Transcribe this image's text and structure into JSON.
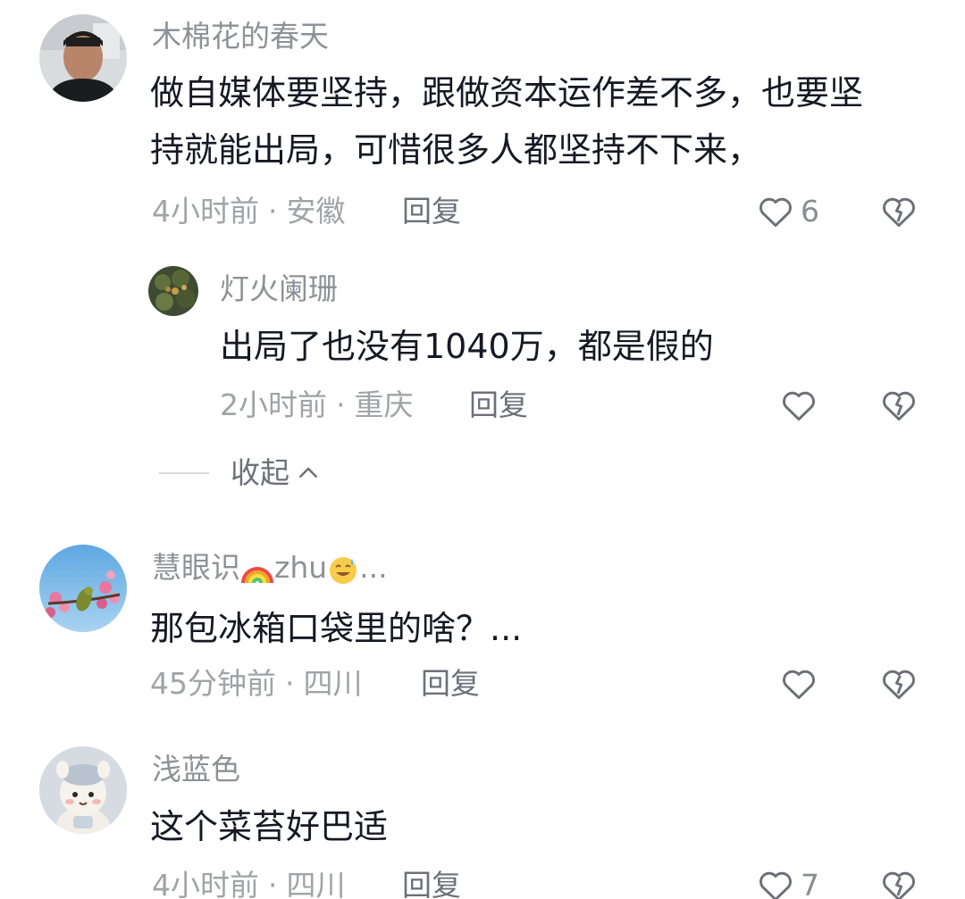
{
  "comments": [
    {
      "username": "木棉花的春天",
      "content_lines": [
        "做自媒体要坚持，跟做资本运作差不多，也要坚",
        "持就能出局，可惜很多人都坚持不下来，"
      ],
      "time": "4小时前",
      "location": "安徽",
      "reply_label": "回复",
      "likes": "6",
      "replies": [
        {
          "username": "灯火阑珊",
          "content": "出局了也没有1040万，都是假的",
          "time": "2小时前",
          "location": "重庆",
          "reply_label": "回复",
          "likes": ""
        }
      ],
      "collapse_label": "收起"
    },
    {
      "username_prefix": "慧眼识",
      "username_mid": "zhu",
      "username_suffix": "...",
      "content": "那包冰箱口袋里的啥？...",
      "time": "45分钟前",
      "location": "四川",
      "reply_label": "回复",
      "likes": ""
    },
    {
      "username": "浅蓝色",
      "content": "这个菜苔好巴适",
      "time": "4小时前",
      "location": "四川",
      "reply_label": "回复",
      "likes": "7"
    }
  ],
  "separator": "·",
  "icons": {
    "like": "heart-outline-icon",
    "dislike": "broken-heart-icon",
    "collapse": "chevron-up-icon"
  },
  "colors": {
    "username": "#8f9197",
    "content": "#161823",
    "meta": "#a1a3a8",
    "icon": "#6d7078"
  }
}
